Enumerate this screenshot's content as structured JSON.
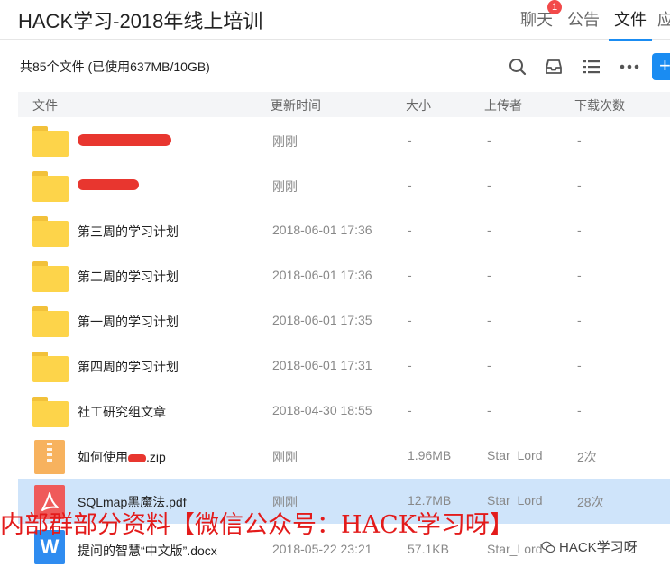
{
  "header": {
    "title": "HACK学习-2018年线上培训",
    "tabs": [
      {
        "label": "聊天",
        "badge": "1"
      },
      {
        "label": "公告"
      },
      {
        "label": "文件",
        "active": true
      },
      {
        "label": "应"
      }
    ]
  },
  "summary": "共85个文件 (已使用637MB/10GB)",
  "toolbar": {
    "icons": [
      "search-icon",
      "inbox-icon",
      "list-view-icon",
      "more-icon",
      "upload-plus-icon"
    ],
    "upload_label": "+"
  },
  "table": {
    "columns": [
      "文件",
      "更新时间",
      "大小",
      "上传者",
      "下载次数"
    ],
    "rows": [
      {
        "icon": "folder",
        "name": "",
        "time": "刚刚",
        "size": "-",
        "uploader": "-",
        "downloads": "-"
      },
      {
        "icon": "folder",
        "name": "",
        "time": "刚刚",
        "size": "-",
        "uploader": "-",
        "downloads": "-"
      },
      {
        "icon": "folder",
        "name": "第三周的学习计划",
        "time": "2018-06-01 17:36",
        "size": "-",
        "uploader": "-",
        "downloads": "-"
      },
      {
        "icon": "folder",
        "name": "第二周的学习计划",
        "time": "2018-06-01 17:36",
        "size": "-",
        "uploader": "-",
        "downloads": "-"
      },
      {
        "icon": "folder",
        "name": "第一周的学习计划",
        "time": "2018-06-01 17:35",
        "size": "-",
        "uploader": "-",
        "downloads": "-"
      },
      {
        "icon": "folder",
        "name": "第四周的学习计划",
        "time": "2018-06-01 17:31",
        "size": "-",
        "uploader": "-",
        "downloads": "-"
      },
      {
        "icon": "folder",
        "name": "社工研究组文章",
        "time": "2018-04-30 18:55",
        "size": "-",
        "uploader": "-",
        "downloads": "-"
      },
      {
        "icon": "zip",
        "name_prefix": "如何使用",
        "name_suffix": ".zip",
        "time": "刚刚",
        "size": "1.96MB",
        "uploader": "Star_Lord",
        "downloads": "2次"
      },
      {
        "icon": "pdf",
        "name": "SQLmap黑魔法.pdf",
        "time": "刚刚",
        "size": "12.7MB",
        "uploader": "Star_Lord",
        "downloads": "28次",
        "selected": true
      },
      {
        "icon": "word",
        "name": "提问的智慧“中文版”.docx",
        "time": "2018-05-22 23:21",
        "size": "57.1KB",
        "uploader": "Star_Lord",
        "downloads": ""
      }
    ]
  },
  "overlay": {
    "watermark": "内部群部分资料【微信公众号：HACK学习呀】",
    "wechat_mark": "HACK学习呀",
    "accent_color": "#1a8cf2",
    "watermark_color": "#e31b1b"
  }
}
